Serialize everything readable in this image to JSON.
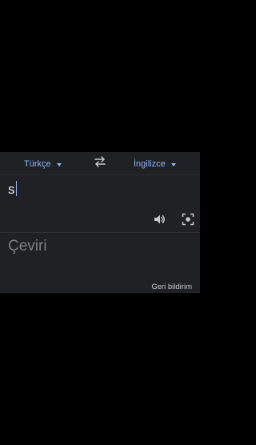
{
  "header": {
    "source_language": "Türkçe",
    "target_language": "İngilizce"
  },
  "input": {
    "text": "s"
  },
  "output": {
    "placeholder": "Çeviri"
  },
  "footer": {
    "feedback_label": "Geri bildirim"
  },
  "icons": {
    "swap": "swap-arrows-icon",
    "speaker": "speaker-icon",
    "camera": "camera-lens-icon"
  },
  "colors": {
    "accent": "#8ab4f8",
    "panel_bg": "#202124",
    "text": "#e8eaed",
    "placeholder": "#7d7e82"
  }
}
